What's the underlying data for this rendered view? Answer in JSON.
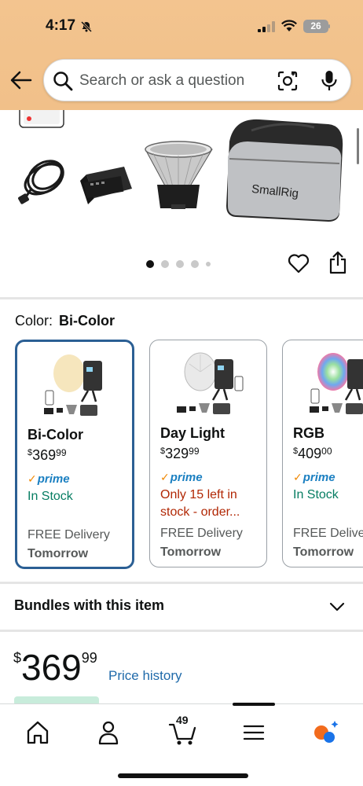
{
  "status_bar": {
    "time": "4:17",
    "battery": "26"
  },
  "search": {
    "placeholder": "Search or ask a question"
  },
  "gallery": {
    "total_images": 5,
    "active_index": 0,
    "brand_on_bag": "SmallRig"
  },
  "color": {
    "label": "Color:",
    "selected": "Bi-Color"
  },
  "variants": [
    {
      "name": "Bi-Color",
      "price_dollars": "369",
      "price_cents": "99",
      "prime": "prime",
      "stock": "In Stock",
      "delivery_1": "FREE Delivery",
      "delivery_2": "Tomorrow"
    },
    {
      "name": "Day Light",
      "price_dollars": "329",
      "price_cents": "99",
      "prime": "prime",
      "stock": "Only 15 left in stock - order...",
      "delivery_1": "FREE Delivery",
      "delivery_2": "Tomorrow"
    },
    {
      "name": "RGB",
      "price_dollars": "409",
      "price_cents": "00",
      "prime": "prime",
      "stock": "In Stock",
      "delivery_1": "FREE Delivery",
      "delivery_2": "Tomorrow"
    }
  ],
  "bundles": {
    "label": "Bundles with this item"
  },
  "price": {
    "currency": "$",
    "dollars": "369",
    "cents": "99",
    "history_link": "Price history"
  },
  "nav": {
    "cart_count": "49"
  }
}
